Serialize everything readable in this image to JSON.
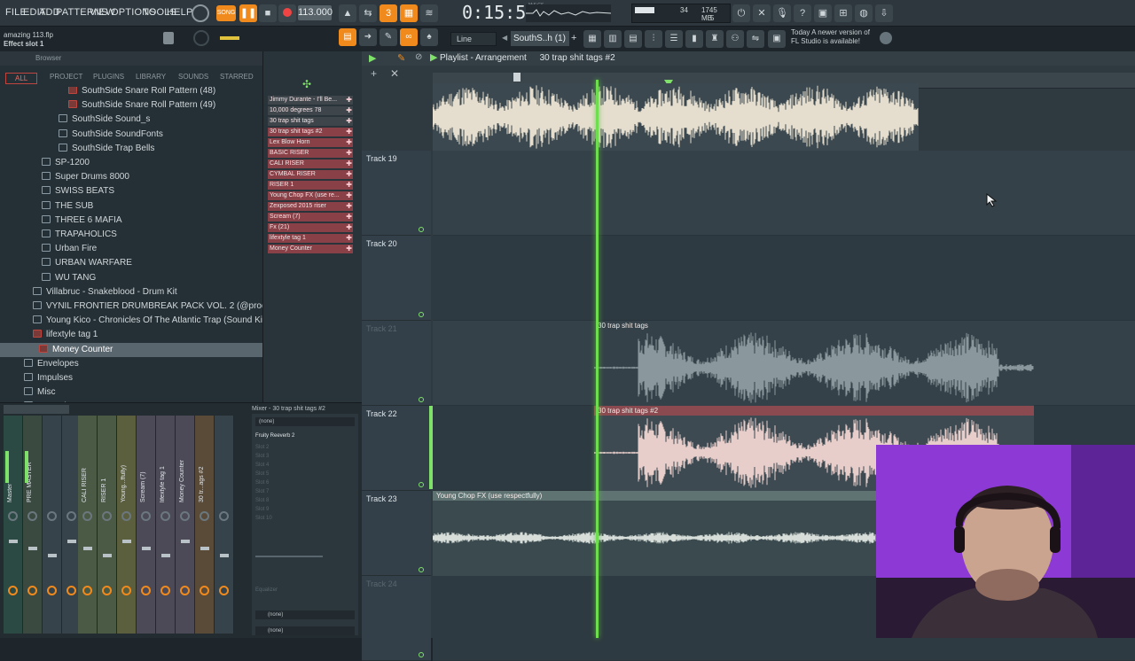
{
  "menu": [
    "FILE",
    "EDIT",
    "ADD",
    "PATTERNS",
    "VIEW",
    "OPTIONS",
    "TOOLS",
    "HELP"
  ],
  "transport": {
    "mode": "SONG",
    "tempo": "113.000",
    "time": "0:15:54",
    "time_unit": "M:S:CS"
  },
  "cpu": {
    "voices": "34",
    "memory": "1745 MB",
    "cores": "5"
  },
  "hint": {
    "line1": "amazing 113.flp",
    "line2": "Effect slot 1"
  },
  "toolbar2": {
    "snap": "Line",
    "pattern": "SouthS..h (1)"
  },
  "news": {
    "line1": "Today  A newer version of",
    "line2": "FL Studio is available!"
  },
  "browser": {
    "title": "Browser",
    "tabs": [
      "ALL",
      "PROJECT",
      "PLUGINS",
      "LIBRARY",
      "SOUNDS",
      "STARRED"
    ],
    "tree": [
      {
        "label": "SouthSide Snare Roll Pattern (48)",
        "indent": 77,
        "type": "file"
      },
      {
        "label": "SouthSide Snare Roll Pattern (49)",
        "indent": 77,
        "type": "file"
      },
      {
        "label": "SouthSide Sound_s",
        "indent": 66,
        "type": "folder"
      },
      {
        "label": "SouthSide SoundFonts",
        "indent": 66,
        "type": "folder"
      },
      {
        "label": "SouthSide Trap Bells",
        "indent": 66,
        "type": "folder"
      },
      {
        "label": "SP-1200",
        "indent": 47,
        "type": "folder"
      },
      {
        "label": "Super Drums 8000",
        "indent": 47,
        "type": "folder"
      },
      {
        "label": "SWISS BEATS",
        "indent": 47,
        "type": "folder"
      },
      {
        "label": "THE SUB",
        "indent": 47,
        "type": "folder"
      },
      {
        "label": "THREE 6 MAFIA",
        "indent": 47,
        "type": "folder"
      },
      {
        "label": "TRAPAHOLICS",
        "indent": 47,
        "type": "folder"
      },
      {
        "label": "Urban Fire",
        "indent": 47,
        "type": "folder"
      },
      {
        "label": "URBAN WARFARE",
        "indent": 47,
        "type": "folder"
      },
      {
        "label": "WU TANG",
        "indent": 47,
        "type": "folder"
      },
      {
        "label": "Villabruc - Snakeblood - Drum Kit",
        "indent": 37,
        "type": "folder"
      },
      {
        "label": "VYNIL FRONTIER DRUMBREAK PACK VOL. 2 (@prodbyermashov)",
        "indent": 37,
        "type": "folder"
      },
      {
        "label": "Young Kico - Chronicles Of The Atlantic Trap (Sound Kit)",
        "indent": 37,
        "type": "folder"
      },
      {
        "label": "lifextyle tag 1",
        "indent": 37,
        "type": "file"
      },
      {
        "label": "Money Counter",
        "indent": 44,
        "type": "selected"
      },
      {
        "label": "Envelopes",
        "indent": 27,
        "type": "folder"
      },
      {
        "label": "Impulses",
        "indent": 27,
        "type": "folder"
      },
      {
        "label": "Misc",
        "indent": 27,
        "type": "folder"
      },
      {
        "label": "My projects",
        "indent": 27,
        "type": "folder"
      }
    ]
  },
  "channels": [
    "Jimmy Durante - I'll Be...",
    "10,000 degrees 78",
    "30 trap shit tags",
    "30 trap shit tags #2",
    "Lex Blow Horn",
    "BASIC RISER",
    "CALI RISER",
    "CYMBAL RISER",
    "RISER 1",
    "Young Chop FX (use re...",
    "Zexposed 2015 riser",
    "Scream (7)",
    "Fx (21)",
    "lifextyle tag 1",
    "Money Counter"
  ],
  "playlist": {
    "title": "Playlist - Arrangement",
    "pattern": "30 trap shit tags #2",
    "tracks": [
      {
        "label": "Track 19"
      },
      {
        "label": "Track 20"
      },
      {
        "label": "Track 21",
        "dim": true
      },
      {
        "label": "Track 22"
      },
      {
        "label": "Track 23"
      },
      {
        "label": "Track 24",
        "dim": true
      }
    ],
    "clips": {
      "top": "",
      "track21": "30 trap shit tags",
      "track22": "30 trap shit tags #2",
      "track23": "Young Chop FX (use respectfully)"
    }
  },
  "mixer": {
    "title": "Mixer - 30 trap shit tags #2",
    "strips": [
      "Master",
      "PRE MASTER",
      "",
      "",
      "CALI RISER",
      "RISER 1",
      "Young...ffully)",
      "Scream (7)",
      "lifextyle tag 1",
      "Money Counter",
      "30 tr...ags #2",
      ""
    ],
    "input": "(none)",
    "slot1": "Fruity Reeverb 2",
    "slots": [
      "Slot 2",
      "Slot 3",
      "Slot 4",
      "Slot 5",
      "Slot 6",
      "Slot 7",
      "Slot 8",
      "Slot 9",
      "Slot 10"
    ],
    "eq_label": "Equalizer",
    "output": "(none)",
    "output2": "(none)"
  },
  "colors": {
    "playhead": "#6ede4f",
    "channel": "#8a4047",
    "accent_orange": "#f08a1c",
    "webcam_bg": "#8d39d6"
  }
}
